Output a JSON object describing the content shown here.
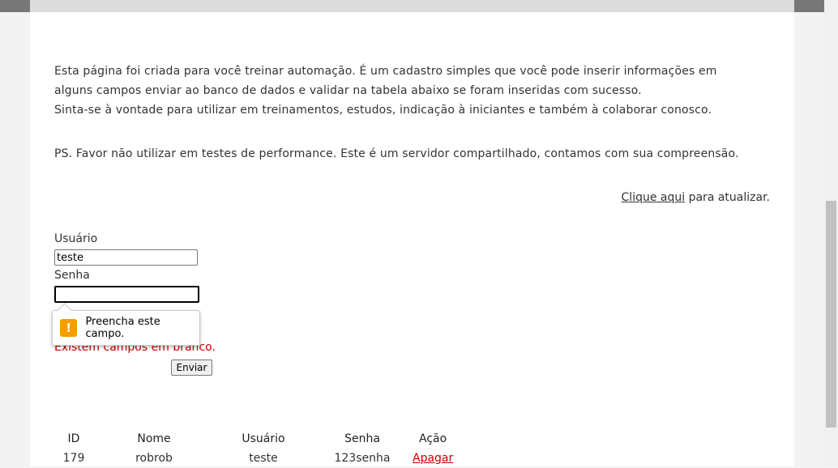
{
  "intro": {
    "line1": "Esta página foi criada para você treinar automação. É um cadastro simples que você pode inserir informações em alguns campos enviar ao banco de dados e validar na tabela abaixo se foram inseridas com sucesso.",
    "line2": "Sinta-se à vontade para utilizar em treinamentos, estudos, indicação à iniciantes e também à colaborar conosco."
  },
  "ps": "PS. Favor não utilizar em testes de performance. Este é um servidor compartilhado, contamos com sua compreensão.",
  "refresh": {
    "link": "Clique aqui",
    "text": " para atualizar."
  },
  "form": {
    "user_label": "Usuário",
    "user_value": "teste",
    "pass_label": "Senha",
    "pass_value": "",
    "error": "Existem campos em branco.",
    "submit": "Enviar"
  },
  "tooltip": {
    "icon": "warning-icon",
    "text": "Preencha este campo."
  },
  "table": {
    "headers": [
      "ID",
      "Nome",
      "Usuário",
      "Senha",
      "Ação"
    ],
    "rows": [
      {
        "id": "179",
        "nome": "robrob",
        "usuario": "teste",
        "senha": "123senha",
        "acao": "Apagar"
      }
    ]
  },
  "colors": {
    "error": "#cc0000",
    "warning": "#f59d00"
  }
}
